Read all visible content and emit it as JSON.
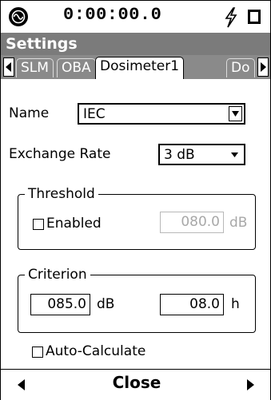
{
  "status": {
    "timer": "0:00:00.0",
    "icons": [
      "app-logo-icon",
      "lightning-bolt-icon",
      "battery-icon"
    ]
  },
  "title": "Settings",
  "tabs": [
    {
      "label": "SLM",
      "active": false
    },
    {
      "label": "OBA",
      "active": false
    },
    {
      "label": "Dosimeter1",
      "active": true
    },
    {
      "label": "Do",
      "active": false
    }
  ],
  "form": {
    "name_label": "Name",
    "name_value": "IEC",
    "exchange_label": "Exchange Rate",
    "exchange_value": "3 dB",
    "threshold": {
      "legend": "Threshold",
      "enabled_label": "Enabled",
      "enabled_checked": false,
      "value": "080.0",
      "unit": "dB",
      "disabled": true
    },
    "criterion": {
      "legend": "Criterion",
      "level_value": "085.0",
      "level_unit": "dB",
      "time_value": "08.0",
      "time_unit": "h"
    },
    "auto_calculate_label": "Auto-Calculate",
    "auto_calculate_checked": false
  },
  "footer": {
    "close_label": "Close"
  },
  "colors": {
    "title_bar": "#7b7b7b",
    "tab_strip": "#8a8a8a",
    "disabled_text": "#a8a8a8"
  }
}
